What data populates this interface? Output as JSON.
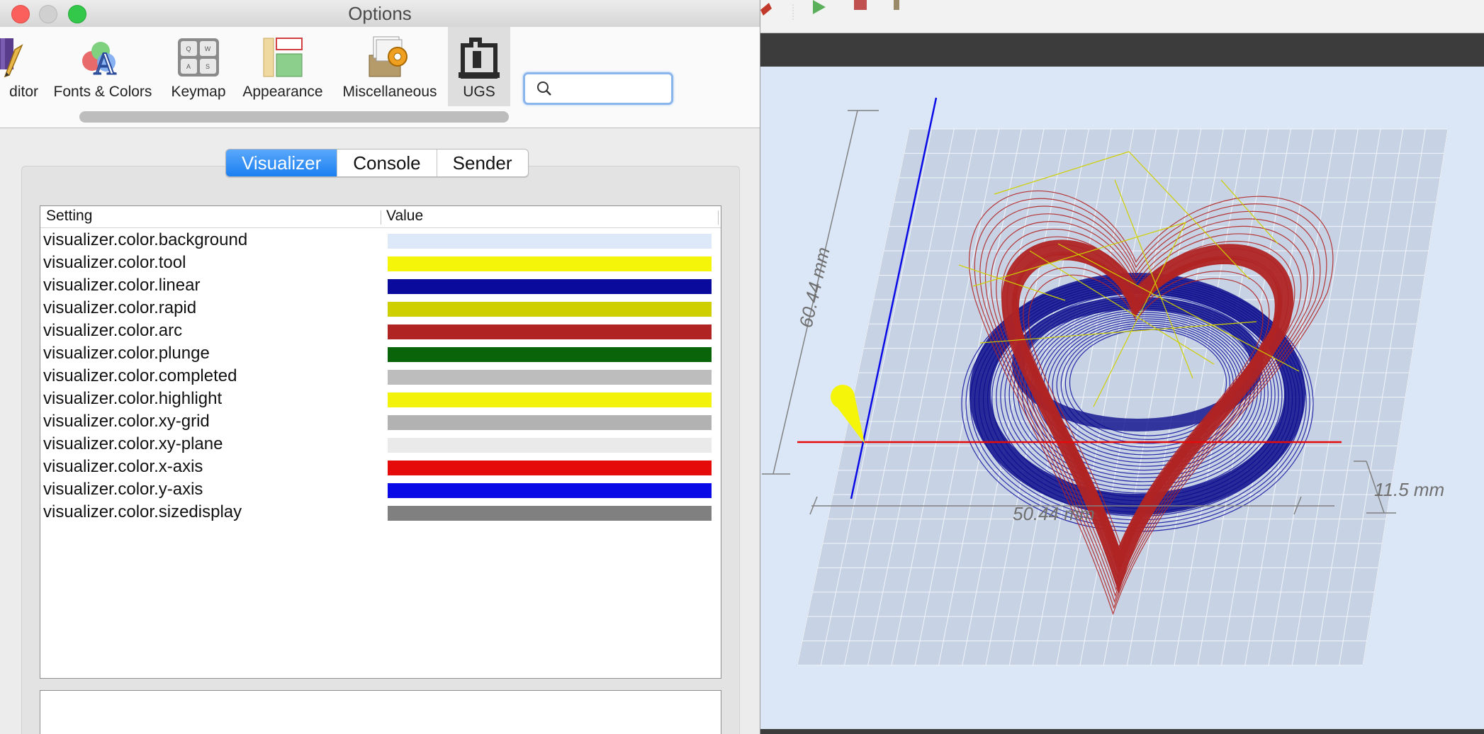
{
  "window": {
    "title": "Options"
  },
  "categories": [
    {
      "id": "editor",
      "label": "ditor",
      "icon": "editor-icon"
    },
    {
      "id": "fonts",
      "label": "Fonts & Colors",
      "icon": "fonts-colors-icon"
    },
    {
      "id": "keymap",
      "label": "Keymap",
      "icon": "keymap-icon"
    },
    {
      "id": "appearance",
      "label": "Appearance",
      "icon": "appearance-icon"
    },
    {
      "id": "misc",
      "label": "Miscellaneous",
      "icon": "miscellaneous-icon"
    },
    {
      "id": "ugs",
      "label": "UGS",
      "icon": "ugs-icon",
      "selected": true
    }
  ],
  "search": {
    "placeholder": "",
    "value": ""
  },
  "tabs": [
    {
      "label": "Visualizer",
      "active": true
    },
    {
      "label": "Console",
      "active": false
    },
    {
      "label": "Sender",
      "active": false
    }
  ],
  "table": {
    "columns": [
      "Setting",
      "Value"
    ],
    "rows": [
      {
        "setting": "visualizer.color.background",
        "color": "#dde9f8"
      },
      {
        "setting": "visualizer.color.tool",
        "color": "#f5f50a"
      },
      {
        "setting": "visualizer.color.linear",
        "color": "#0a0a9c"
      },
      {
        "setting": "visualizer.color.rapid",
        "color": "#cfcf00"
      },
      {
        "setting": "visualizer.color.arc",
        "color": "#b02424"
      },
      {
        "setting": "visualizer.color.plunge",
        "color": "#0a640a"
      },
      {
        "setting": "visualizer.color.completed",
        "color": "#bdbdbd"
      },
      {
        "setting": "visualizer.color.highlight",
        "color": "#f2f20a"
      },
      {
        "setting": "visualizer.color.xy-grid",
        "color": "#b2b2b2"
      },
      {
        "setting": "visualizer.color.xy-plane",
        "color": "#eaeaea"
      },
      {
        "setting": "visualizer.color.x-axis",
        "color": "#e60b0b"
      },
      {
        "setting": "visualizer.color.y-axis",
        "color": "#0a0ae6"
      },
      {
        "setting": "visualizer.color.sizedisplay",
        "color": "#808080"
      }
    ]
  },
  "visualizer": {
    "dim_y": "60.44 mm",
    "dim_x": "50.44 mm",
    "dim_z": "11.5 mm"
  }
}
